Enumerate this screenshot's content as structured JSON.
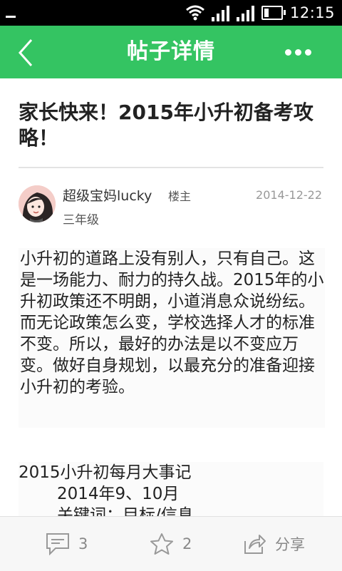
{
  "status_bar": {
    "time": "12:15"
  },
  "header": {
    "title": "帖子详情"
  },
  "post": {
    "title": "家长快来！2015年小升初备考攻略！",
    "author": "超级宝妈lucky",
    "author_tag": "楼主",
    "date": "2014-12-22",
    "grade": "三年级",
    "paragraph_1": " 小升初的道路上没有别人，只有自己。这是一场能力、耐力的持久战。2015年的小升初政策还不明朗，小道消息众说纷纭。而无论政策怎么变，学校选择人才的标准不变。所以，最好的办法是以不变应万变。做好自身规划，以最充分的准备迎接小升初的考验。",
    "paragraph_2_lines": [
      "2015小升初每月大事记",
      "2014年9、10月",
      "关键词：目标/信息"
    ]
  },
  "actions": {
    "comment_count": "3",
    "like_count": "2",
    "share_label": "分享"
  },
  "colors": {
    "accent": "#34c462"
  }
}
